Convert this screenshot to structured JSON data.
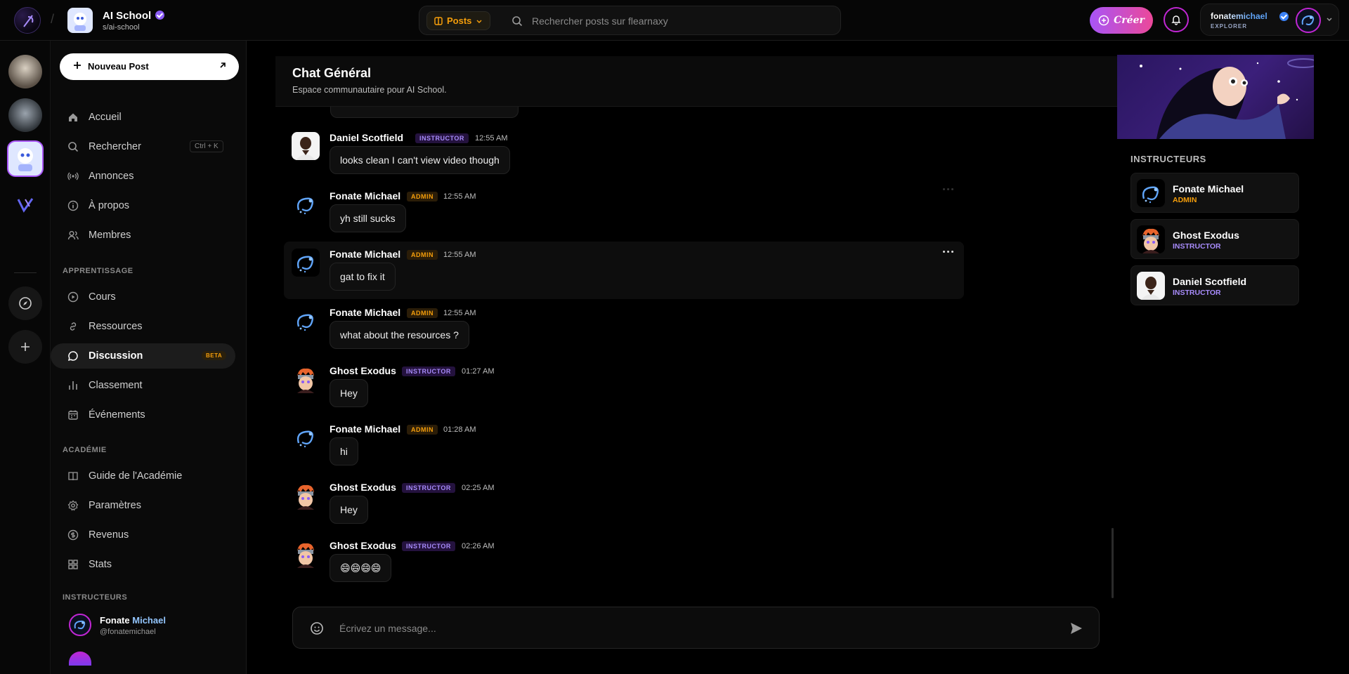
{
  "topbar": {
    "school_name": "AI School",
    "school_slug": "s/ai-school",
    "posts_label": "Posts",
    "search_placeholder": "Rechercher posts sur flearnaxy",
    "create_label": "Créer",
    "user_name": "fonatemichael",
    "user_role": "EXPLORER"
  },
  "sidebar": {
    "new_post": "Nouveau Post",
    "nav": [
      {
        "label": "Accueil",
        "icon": "home-icon"
      },
      {
        "label": "Rechercher",
        "icon": "search-icon",
        "shortcut": "Ctrl + K"
      },
      {
        "label": "Annonces",
        "icon": "broadcast-icon"
      },
      {
        "label": "À propos",
        "icon": "info-icon"
      },
      {
        "label": "Membres",
        "icon": "users-icon"
      }
    ],
    "learning_label": "APPRENTISSAGE",
    "learning": [
      {
        "label": "Cours",
        "icon": "play-circle-icon"
      },
      {
        "label": "Ressources",
        "icon": "link-icon"
      },
      {
        "label": "Discussion",
        "icon": "chat-icon",
        "badge": "BETA",
        "active": true
      },
      {
        "label": "Classement",
        "icon": "bar-chart-icon"
      },
      {
        "label": "Événements",
        "icon": "calendar-icon"
      }
    ],
    "academy_label": "ACADÉMIE",
    "academy": [
      {
        "label": "Guide de l'Académie",
        "icon": "book-icon"
      },
      {
        "label": "Paramètres",
        "icon": "settings-icon"
      },
      {
        "label": "Revenus",
        "icon": "dollar-icon"
      },
      {
        "label": "Stats",
        "icon": "grid-icon"
      }
    ],
    "instructors_label": "INSTRUCTEURS",
    "instructor": {
      "first": "Fonate",
      "last": "Michael",
      "handle": "@fonatemichael"
    }
  },
  "chat": {
    "title": "Chat Général",
    "subtitle": "Espace communautaire pour AI School.",
    "composer_placeholder": "Écrivez un message...",
    "messages": [
      {
        "name": "Daniel Scotfield",
        "role": "INSTRUCTOR",
        "time": "12:55 AM",
        "text": "looks clean I can't view video though",
        "avatar": "daniel"
      },
      {
        "name": "Fonate Michael",
        "role": "ADMIN",
        "time": "12:55 AM",
        "text": "yh still sucks",
        "avatar": "fonate"
      },
      {
        "name": "Fonate Michael",
        "role": "ADMIN",
        "time": "12:55 AM",
        "text": "gat to fix it",
        "avatar": "fonate"
      },
      {
        "name": "Fonate Michael",
        "role": "ADMIN",
        "time": "12:55 AM",
        "text": "what about the resources ?",
        "avatar": "fonate"
      },
      {
        "name": "Ghost Exodus",
        "role": "INSTRUCTOR",
        "time": "01:27 AM",
        "text": "Hey",
        "avatar": "ghost"
      },
      {
        "name": "Fonate Michael",
        "role": "ADMIN",
        "time": "01:28 AM",
        "text": "hi",
        "avatar": "fonate"
      },
      {
        "name": "Ghost Exodus",
        "role": "INSTRUCTOR",
        "time": "02:25 AM",
        "text": "Hey",
        "avatar": "ghost"
      },
      {
        "name": "Ghost Exodus",
        "role": "INSTRUCTOR",
        "time": "02:26 AM",
        "text": "😄😄😄😄",
        "avatar": "ghost"
      }
    ]
  },
  "right_panel": {
    "label": "INSTRUCTEURS",
    "instructors": [
      {
        "name": "Fonate Michael",
        "role": "ADMIN",
        "avatar": "fonate"
      },
      {
        "name": "Ghost Exodus",
        "role": "INSTRUCTOR",
        "avatar": "ghost"
      },
      {
        "name": "Daniel Scotfield",
        "role": "INSTRUCTOR",
        "avatar": "daniel"
      }
    ]
  },
  "colors": {
    "admin": "#f59e0b",
    "instructor": "#a78bfa",
    "accent": "#c026d3"
  }
}
